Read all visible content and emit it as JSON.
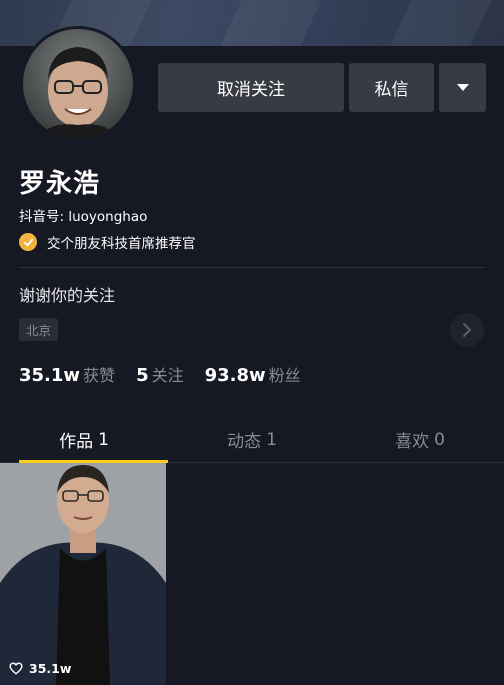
{
  "profile": {
    "name": "罗永浩",
    "douyin_id": "抖音号: luoyonghao",
    "verification": "交个朋友科技首席推荐官",
    "bio": "谢谢你的关注",
    "location": "北京"
  },
  "actions": {
    "unfollow_label": "取消关注",
    "message_label": "私信",
    "more_icon": "caret-down-icon"
  },
  "stats": [
    {
      "value": "35.1w",
      "label": "获赞"
    },
    {
      "value": "5",
      "label": "关注"
    },
    {
      "value": "93.8w",
      "label": "粉丝"
    }
  ],
  "tabs": [
    {
      "label": "作品",
      "count": "1",
      "active": true
    },
    {
      "label": "动态",
      "count": "1",
      "active": false
    },
    {
      "label": "喜欢",
      "count": "0",
      "active": false
    }
  ],
  "videos": [
    {
      "likes": "35.1w"
    }
  ],
  "colors": {
    "background": "#161823",
    "button": "#393b44",
    "tab_indicator": "#face15",
    "verify_badge": "#f4b23e",
    "muted_text": "#8a8b91"
  }
}
